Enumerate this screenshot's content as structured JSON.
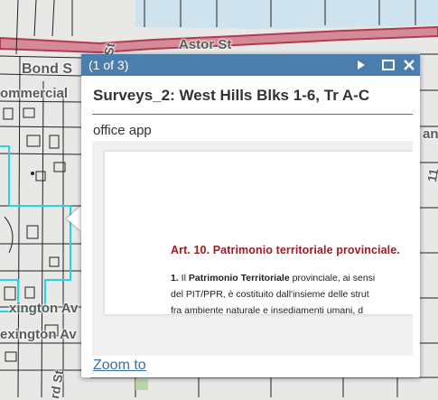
{
  "map": {
    "labels": {
      "astor": "Astor St",
      "bond": "Bond S",
      "commercial": "ommercial",
      "exington1": "xington Av",
      "exington2": "exington Av",
      "st_top": "St",
      "st_bottom": "rd St",
      "right_fragment": "an",
      "right_fragment2": "11"
    },
    "colors": {
      "road_fill": "#d58a98",
      "road_edge": "#b23a52",
      "water": "#cfe3ee",
      "parcel_line": "#222222",
      "highlight": "#22d4e6",
      "background": "#e8e8e6"
    }
  },
  "popup": {
    "counter": "(1 of 3)",
    "header_color": "#4c7eab",
    "buttons": {
      "next": "next-arrow-icon",
      "maximize": "maximize-icon",
      "close": "close-icon"
    },
    "title": "Surveys_2: West Hills Blks 1-6, Tr A-C",
    "field_label": "office app",
    "attachment": {
      "heading": "Art. 10. Patrimonio territoriale provinciale.",
      "line1_num": "1.",
      "line1_pre": " Il ",
      "line1_bold": "Patrimonio Territoriale",
      "line1_post": " provinciale, ai sensi",
      "line2": "del PIT/PPR, è costituito dall'insieme delle strut",
      "line3": "fra ambiente naturale e insediamenti umani, d"
    },
    "zoom_link": "Zoom to"
  }
}
